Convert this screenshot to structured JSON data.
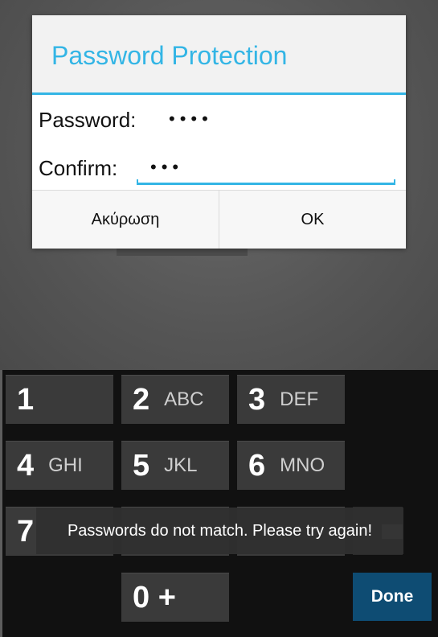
{
  "dialog": {
    "title": "Password Protection",
    "password_label": "Password:",
    "password_value": "••••",
    "confirm_label": "Confirm:",
    "confirm_value": "•••",
    "cancel_label": "Ακύρωση",
    "ok_label": "OK"
  },
  "keypad": {
    "keys": [
      {
        "num": "1",
        "letters": ""
      },
      {
        "num": "2",
        "letters": "ABC"
      },
      {
        "num": "3",
        "letters": "DEF"
      },
      {
        "num": "4",
        "letters": "GHI"
      },
      {
        "num": "5",
        "letters": "JKL"
      },
      {
        "num": "6",
        "letters": "MNO"
      },
      {
        "num": "7",
        "letters": ""
      },
      {
        "num": "0 +",
        "letters": ""
      }
    ],
    "done_label": "Done"
  },
  "toast": {
    "message": "Passwords do not match. Please try again!"
  },
  "colors": {
    "accent": "#33b5e5",
    "done_key": "#0e4c73",
    "key_bg": "#3a3a3a"
  }
}
